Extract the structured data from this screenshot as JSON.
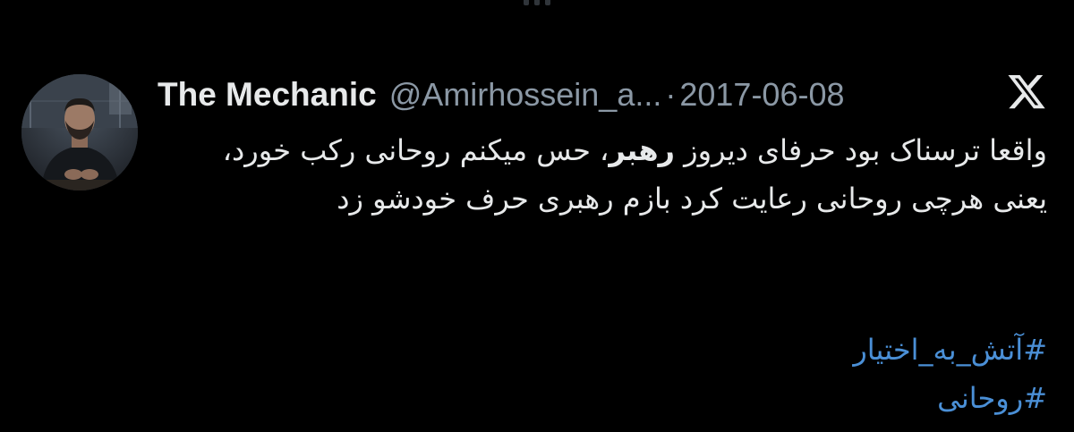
{
  "tweet": {
    "display_name": "The Mechanic",
    "handle": "@Amirhossein_a...",
    "separator": "·",
    "date": "2017-06-08",
    "text_part1": "واقعا ترسناک بود حرفای دیروز ",
    "text_bold": "رهبر",
    "text_part2": "، حس میکنم روحانی رکب خورد، یعنی هرچی روحانی رعایت کرد بازم رهبری حرف خودشو زد",
    "hashtags": [
      "#آتش_به_اختیار",
      "#روحانی"
    ]
  },
  "icons": {
    "platform_logo": "x-logo-icon",
    "avatar": "avatar-photo"
  },
  "colors": {
    "background": "#000000",
    "primary_text": "#e7e9ea",
    "secondary_text": "#8b98a5",
    "hashtag": "#4a8fd6"
  }
}
